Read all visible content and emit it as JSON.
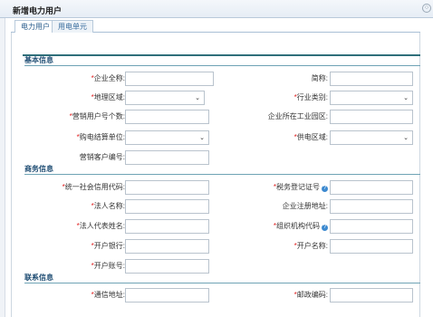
{
  "window": {
    "title": "新增电力用户",
    "close_glyph": "○"
  },
  "tabs": [
    {
      "label": "电力用户",
      "active": true
    },
    {
      "label": "用电单元",
      "active": false
    }
  ],
  "sections": {
    "basic": "基本信息",
    "business": "商务信息",
    "contact": "联系信息"
  },
  "fields": {
    "company_name": {
      "label": "企业全称:",
      "required": true
    },
    "short_name": {
      "label": "简称:",
      "required": false
    },
    "region": {
      "label": "地理区域:",
      "required": true
    },
    "industry": {
      "label": "行业类别:",
      "required": true
    },
    "account_count": {
      "label": "营销用户号个数:",
      "required": true
    },
    "park": {
      "label": "企业所在工业园区:",
      "required": false
    },
    "settlement_unit": {
      "label": "购电结算单位:",
      "required": true
    },
    "supply_area": {
      "label": "供电区域:",
      "required": true
    },
    "customer_no": {
      "label": "营销客户编号:",
      "required": false
    },
    "credit_code": {
      "label": "统一社会信用代码:",
      "required": true
    },
    "tax_cert": {
      "label": "税务登记证号",
      "required": true
    },
    "legal_name": {
      "label": "法人名称:",
      "required": true
    },
    "reg_address": {
      "label": "企业注册地址:",
      "required": false
    },
    "legal_rep": {
      "label": "法人代表姓名:",
      "required": true
    },
    "org_code": {
      "label": "组织机构代码",
      "required": true
    },
    "bank": {
      "label": "开户银行:",
      "required": true
    },
    "account_name": {
      "label": "开户名称:",
      "required": true
    },
    "account_no": {
      "label": "开户账号:",
      "required": true
    },
    "address": {
      "label": "通信地址:",
      "required": true
    },
    "postcode": {
      "label": "邮政编码:",
      "required": true
    }
  },
  "req_mark": "*",
  "help_glyph": "?",
  "select_arrow": "⌄",
  "icons": {
    "help": "help-circle-icon",
    "dropdown": "chevron-down-icon",
    "close": "close-circle-icon"
  },
  "colors": {
    "section_text": "#1f4d73",
    "required": "#e02020",
    "tab_text": "#3a6e9e",
    "accent_line": "#2f6f7a"
  }
}
